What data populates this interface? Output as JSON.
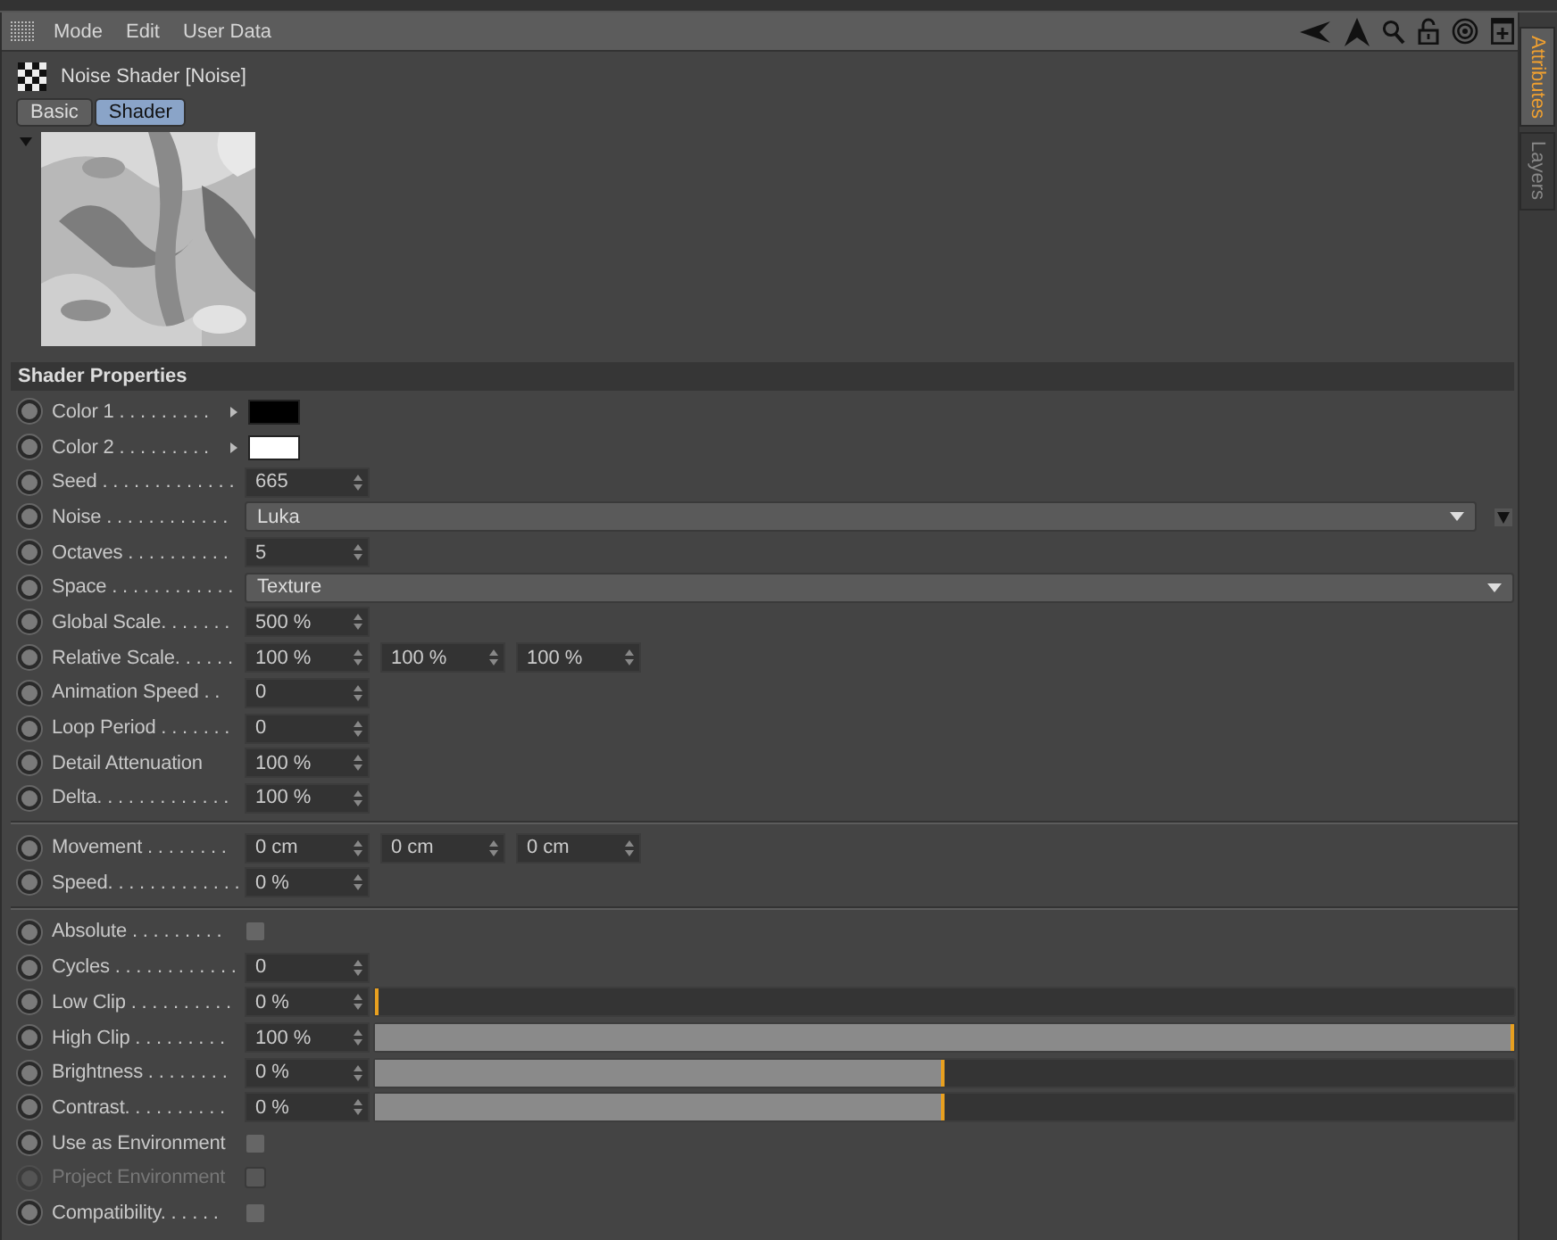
{
  "menu": [
    "Mode",
    "Edit",
    "User Data"
  ],
  "object": {
    "title": "Noise Shader [Noise]"
  },
  "tabs": [
    {
      "label": "Basic",
      "selected": false
    },
    {
      "label": "Shader",
      "selected": true
    }
  ],
  "preview": {
    "kind": "picture"
  },
  "side_tabs": [
    {
      "label": "Attributes",
      "selected": true
    },
    {
      "label": "Layers",
      "selected": false
    }
  ],
  "section": {
    "title": "Shader Properties"
  },
  "groups": [
    [
      {
        "kind": "color",
        "label": "Color 1 . . . . . . . . .",
        "color": "#000000"
      },
      {
        "kind": "color",
        "label": "Color 2 . . . . . . . . .",
        "color": "#ffffff"
      },
      {
        "kind": "number",
        "label": "Seed . . . . . . . . . . . . .",
        "values": [
          "665"
        ]
      },
      {
        "kind": "dropdown",
        "label": "Noise . . . . . . . . . . . .",
        "value": "Luka",
        "extra_button": true
      },
      {
        "kind": "number",
        "label": "Octaves . . . . . . . . . .",
        "values": [
          "5"
        ]
      },
      {
        "kind": "dropdown",
        "label": "Space . . . . . . . . . . . .",
        "value": "Texture",
        "extra_button": false
      },
      {
        "kind": "number",
        "label": "Global Scale. . . . . . .",
        "values": [
          "500 %"
        ]
      },
      {
        "kind": "number",
        "label": "Relative Scale. . . . . .",
        "values": [
          "100 %",
          "100 %",
          "100 %"
        ]
      },
      {
        "kind": "number",
        "label": "Animation Speed . .",
        "values": [
          "0"
        ]
      },
      {
        "kind": "number",
        "label": "Loop Period . . . . . . .",
        "values": [
          "0"
        ]
      },
      {
        "kind": "number",
        "label": "Detail Attenuation",
        "values": [
          "100 %"
        ]
      },
      {
        "kind": "number",
        "label": "Delta. . . . . . . . . . . . .",
        "values": [
          "100 %"
        ]
      }
    ],
    [
      {
        "kind": "number",
        "label": "Movement . . . . . . . .",
        "values": [
          "0 cm",
          "0 cm",
          "0 cm"
        ]
      },
      {
        "kind": "number",
        "label": "Speed. . . . . . . . . . . . .",
        "values": [
          "0 %"
        ]
      }
    ],
    [
      {
        "kind": "checkbox",
        "label": "Absolute . . . . . . . . .",
        "checked": false,
        "disabled": false
      },
      {
        "kind": "number",
        "label": "Cycles . . . . . . . . . . . .",
        "values": [
          "0"
        ]
      },
      {
        "kind": "slider",
        "label": "Low Clip . . . . . . . . . .",
        "value": "0 %",
        "level": 0
      },
      {
        "kind": "slider",
        "label": "High Clip . . . . . . . . .",
        "value": "100 %",
        "level": 1
      },
      {
        "kind": "slider",
        "label": "Brightness . . . . . . . .",
        "value": "0 %",
        "level": 0.5
      },
      {
        "kind": "slider",
        "label": "Contrast. . . . . . . . . .",
        "value": "0 %",
        "level": 0.5
      },
      {
        "kind": "checkbox",
        "label": "Use as Environment",
        "checked": false,
        "disabled": false
      },
      {
        "kind": "checkbox",
        "label": "Project Environment",
        "checked": false,
        "disabled": true
      },
      {
        "kind": "checkbox",
        "label": "Compatibility. . . . . .",
        "checked": false,
        "disabled": false
      }
    ]
  ]
}
